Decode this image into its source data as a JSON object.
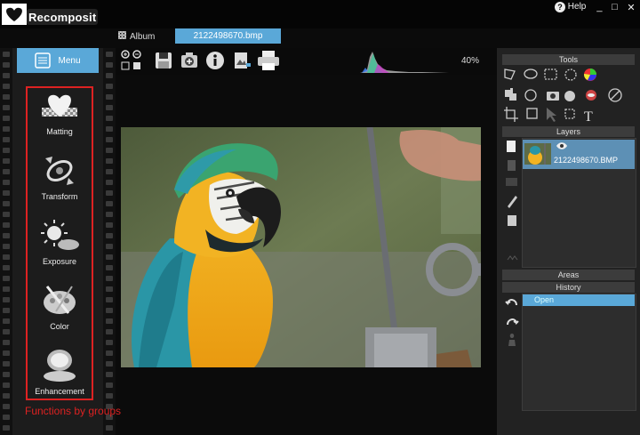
{
  "app": {
    "name": "Recomposit"
  },
  "window": {
    "help_label": "Help",
    "minimize": "_",
    "maximize": "□",
    "close": "✕"
  },
  "tabs": {
    "album_label": "Album",
    "file_label": "2122498670.bmp"
  },
  "left_menu": {
    "menu_label": "Menu",
    "items": [
      {
        "label": "Matting",
        "icon": "heart-icon"
      },
      {
        "label": "Transform",
        "icon": "transform-icon"
      },
      {
        "label": "Exposure",
        "icon": "exposure-icon"
      },
      {
        "label": "Color",
        "icon": "palette-icon"
      },
      {
        "label": "Enhancement",
        "icon": "compact-mirror-icon"
      }
    ],
    "caption": "Functions by groups"
  },
  "toolbar": {
    "zoom": "40%"
  },
  "right_panel": {
    "tools_title": "Tools",
    "layers_title": "Layers",
    "layer_name": "2122498670.BMP",
    "areas_title": "Areas",
    "history_title": "History",
    "history_items": [
      "Open"
    ]
  },
  "colors": {
    "accent": "#5aa8d8",
    "highlight_red": "#dd2222",
    "layer_selected": "#5d90b5"
  }
}
